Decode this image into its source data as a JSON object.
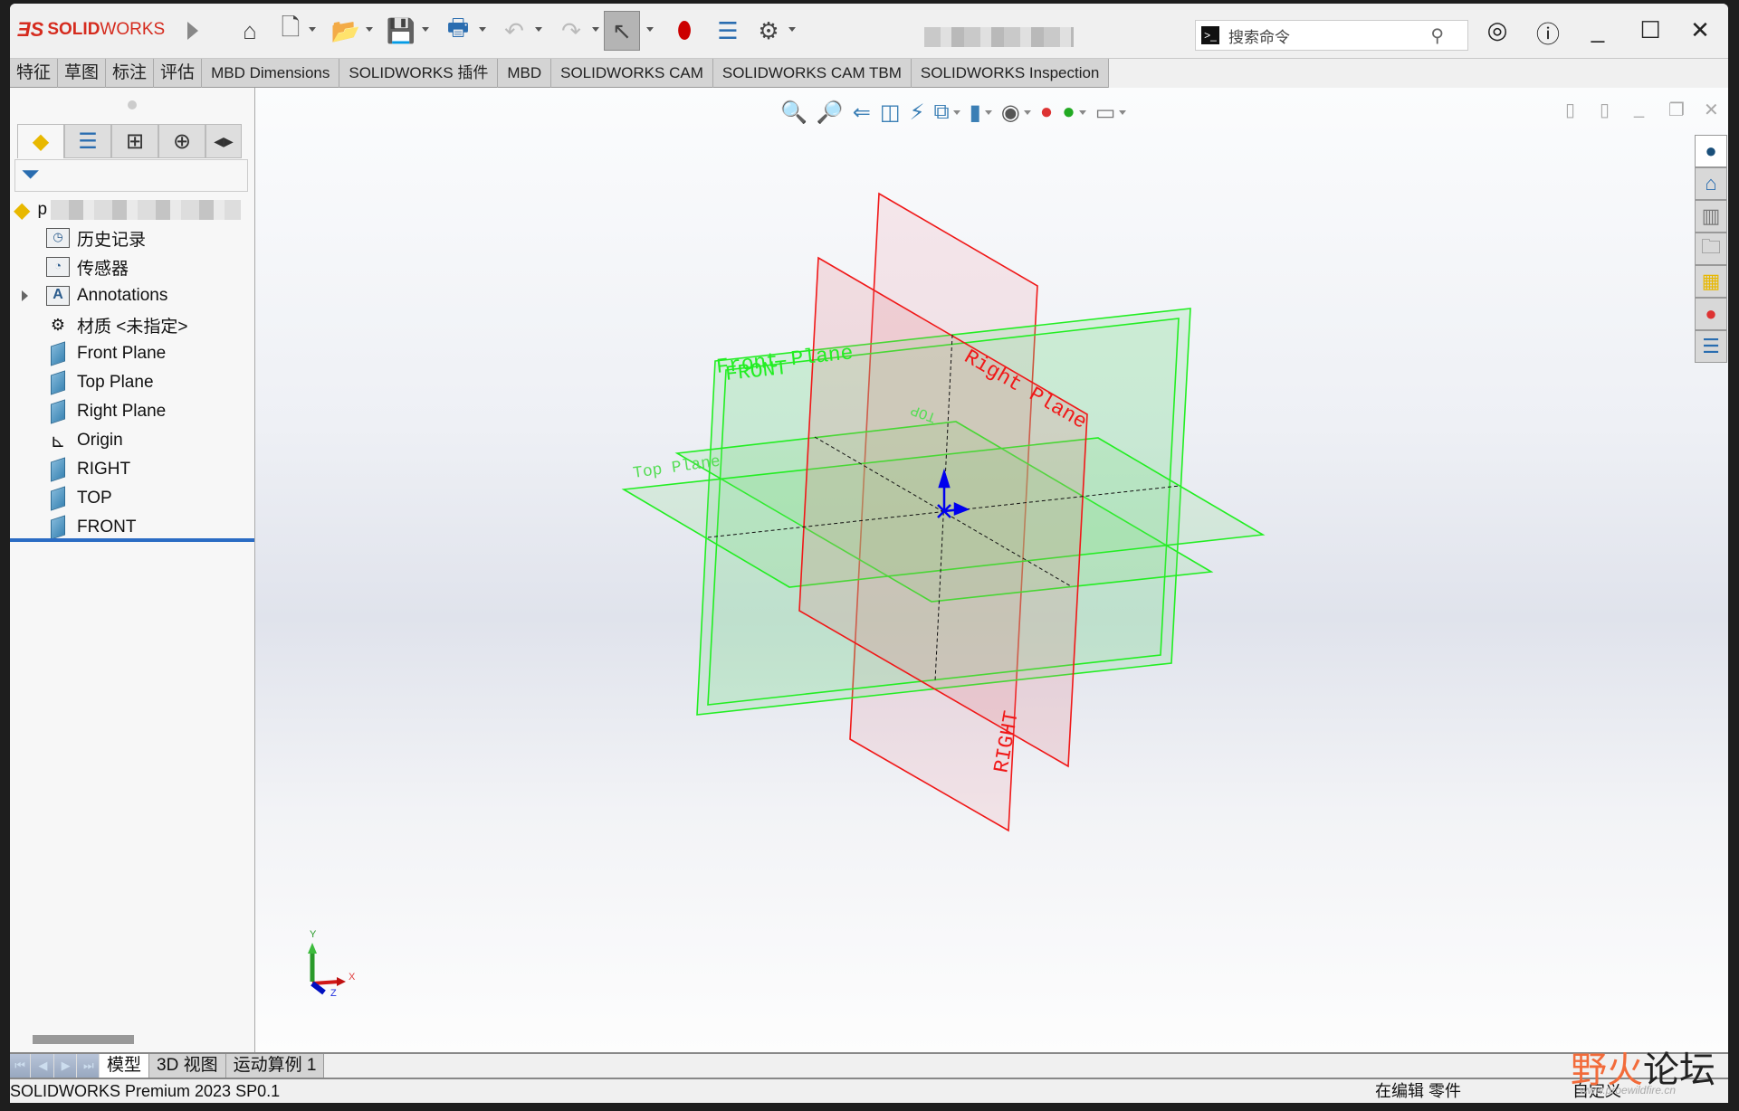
{
  "app": {
    "logo": "SOLIDWORKS",
    "logo_ds": "3S"
  },
  "toolbar": {
    "items": [
      "home-icon",
      "new-document-icon",
      "open-icon",
      "save-icon",
      "print-icon",
      "undo-icon",
      "redo-icon",
      "select-icon",
      "rebuild-icon",
      "file-properties-icon",
      "options-icon"
    ]
  },
  "search": {
    "placeholder": "搜索命令"
  },
  "ribbon": {
    "tabs": [
      "特征",
      "草图",
      "标注",
      "评估",
      "MBD Dimensions",
      "SOLIDWORKS 插件",
      "MBD",
      "SOLIDWORKS CAM",
      "SOLIDWORKS CAM TBM",
      "SOLIDWORKS Inspection"
    ]
  },
  "tree": {
    "root": "p",
    "items": [
      {
        "label": "历史记录",
        "icon": "history-folder-icon"
      },
      {
        "label": "传感器",
        "icon": "sensors-folder-icon"
      },
      {
        "label": "Annotations",
        "icon": "annotations-folder-icon",
        "expandable": true
      },
      {
        "label": "材质 <未指定>",
        "icon": "material-icon"
      },
      {
        "label": "Front Plane",
        "icon": "plane-icon"
      },
      {
        "label": "Top Plane",
        "icon": "plane-icon"
      },
      {
        "label": "Right Plane",
        "icon": "plane-icon"
      },
      {
        "label": "Origin",
        "icon": "origin-icon"
      },
      {
        "label": "RIGHT",
        "icon": "plane-icon"
      },
      {
        "label": "TOP",
        "icon": "plane-icon"
      },
      {
        "label": "FRONT",
        "icon": "plane-icon"
      }
    ]
  },
  "viewport": {
    "labels": {
      "front_plane": "Front Plane",
      "front": "FRONT",
      "right_plane": "Right Plane",
      "right": "RIGHT",
      "top_plane": "Top Plane",
      "top": "TOP"
    },
    "triad": {
      "x": "X",
      "y": "Y",
      "z": "Z"
    },
    "colors": {
      "green_plane": "#22ee22",
      "red_plane": "#ee1111",
      "origin": "#0000ee"
    }
  },
  "bottom_tabs": [
    "模型",
    "3D 视图",
    "运动算例 1"
  ],
  "status": {
    "product": "SOLIDWORKS Premium 2023 SP0.1",
    "mode": "在编辑 零件",
    "units": "自定义"
  },
  "watermark": {
    "a": "野火",
    "b": "论坛",
    "url": "www.proewildfire.cn"
  }
}
